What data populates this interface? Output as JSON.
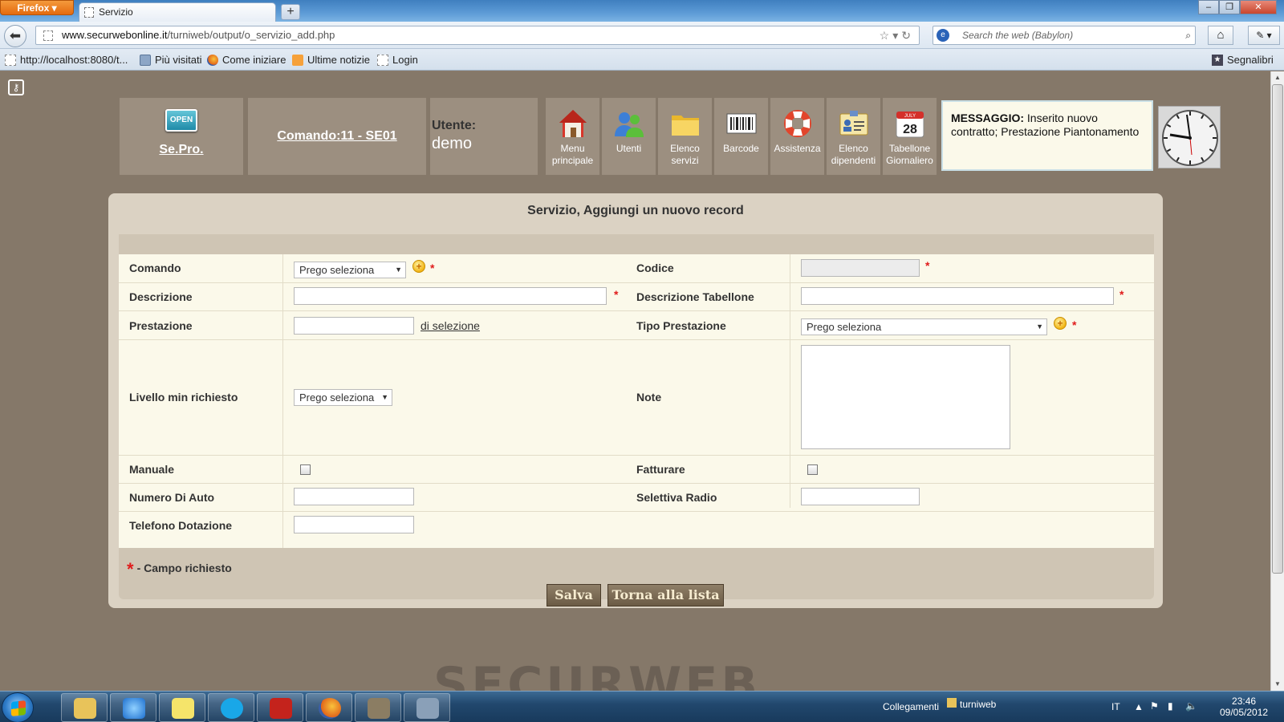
{
  "browser": {
    "menu_button": "Firefox",
    "tab_title": "Servizio",
    "new_tab": "+",
    "window_controls": [
      "–",
      "❐",
      "✕"
    ],
    "url_host": "www.securwebonline.it",
    "url_path": "/turniweb/output/o_servizio_add.php",
    "search_placeholder": "Search the web (Babylon)",
    "bookmarks": [
      {
        "label": "http://localhost:8080/t...",
        "icon": "blank-page-icon"
      },
      {
        "label": "Più visitati",
        "icon": "folder-icon"
      },
      {
        "label": "Come iniziare",
        "icon": "firefox-icon"
      },
      {
        "label": "Ultime notizie",
        "icon": "rss-icon"
      },
      {
        "label": "Login",
        "icon": "blank-page-icon"
      }
    ],
    "bookmarks_menu": "Segnalibri"
  },
  "header": {
    "logo_badge": "OPEN",
    "logo_name": "Se.Pro.",
    "comando": "Comando:11 - SE01",
    "user_label": "Utente:",
    "user_name": "demo",
    "menu": [
      {
        "label": "Menu principale",
        "icon": "house-icon"
      },
      {
        "label": "Utenti",
        "icon": "users-icon"
      },
      {
        "label": "Elenco servizi",
        "icon": "folder-icon"
      },
      {
        "label": "Barcode",
        "icon": "barcode-icon"
      },
      {
        "label": "Assistenza",
        "icon": "lifebuoy-icon"
      },
      {
        "label": "Elenco dipendenti",
        "icon": "id-card-icon"
      },
      {
        "label": "Tabellone Giornaliero",
        "icon": "calendar-icon",
        "calendar_month": "JULY",
        "calendar_day": "28"
      }
    ],
    "message_label": "MESSAGGIO:",
    "message_text": "Inserito nuovo contratto; Prestazione Piantonamento",
    "clock_time": "23:46"
  },
  "form": {
    "title": "Servizio, Aggiungi un nuovo record",
    "select_default": "Prego seleziona",
    "fields": {
      "comando": {
        "label": "Comando",
        "value": "Prego seleziona",
        "required": true
      },
      "codice": {
        "label": "Codice",
        "value": "",
        "required": true
      },
      "descrizione": {
        "label": "Descrizione",
        "value": "",
        "required": true
      },
      "descrizione_tabellone": {
        "label": "Descrizione Tabellone",
        "value": "",
        "required": true
      },
      "prestazione": {
        "label": "Prestazione",
        "value": "",
        "link": "di selezione"
      },
      "tipo_prestazione": {
        "label": "Tipo Prestazione",
        "value": "Prego seleziona",
        "required": true
      },
      "livello": {
        "label": "Livello min richiesto",
        "value": "Prego seleziona"
      },
      "note": {
        "label": "Note",
        "value": ""
      },
      "manuale": {
        "label": "Manuale",
        "checked": false
      },
      "fatturare": {
        "label": "Fatturare",
        "checked": false
      },
      "numero_auto": {
        "label": "Numero Di Auto",
        "value": ""
      },
      "selettiva_radio": {
        "label": "Selettiva Radio",
        "value": ""
      },
      "telefono": {
        "label": "Telefono Dotazione",
        "value": ""
      }
    },
    "required_mark": "*",
    "required_legend": "- Campo richiesto",
    "save_label": "Salva",
    "back_label": "Torna alla lista"
  },
  "watermark": "SECURWEB",
  "taskbar": {
    "apps": [
      "file-explorer-icon",
      "internet-explorer-icon",
      "notes-icon",
      "skype-icon",
      "filezilla-icon",
      "firefox-icon",
      "gimp-icon",
      "usb-drive-icon"
    ],
    "links_label": "Collegamenti",
    "folder_label": "turniweb",
    "language": "IT",
    "time": "23:46",
    "date": "09/05/2012"
  }
}
